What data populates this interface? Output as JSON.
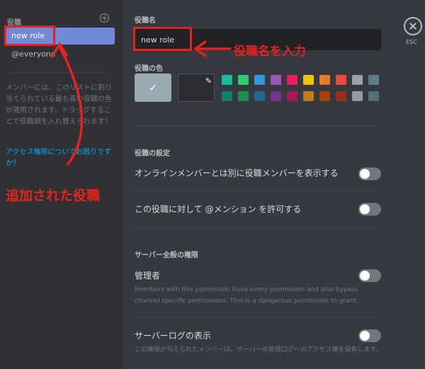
{
  "sidebar": {
    "title": "役職",
    "selected_role": "new role",
    "everyone_role": "@everyone",
    "description": "メンバーには、このリストに割り当てられている最も高い役職の色が適用されます。ドラッグすることで役職順を入れ替えられます！",
    "help_link": "アクセス権限についてお困りですか？"
  },
  "role_name": {
    "label": "役職名",
    "value": "new role"
  },
  "role_color": {
    "label": "役職の色",
    "default_color": "#99aab5",
    "swatches_top": [
      "#1abc9c",
      "#2ecc71",
      "#3498db",
      "#9b59b6",
      "#e91e63",
      "#f1c40f",
      "#e67e22",
      "#e74c3c",
      "#95a5a6",
      "#607d8b"
    ],
    "swatches_bottom": [
      "#11806a",
      "#1f8b4c",
      "#206694",
      "#71368a",
      "#ad1457",
      "#c27c0e",
      "#a84300",
      "#992d22",
      "#979c9f",
      "#546e7a"
    ]
  },
  "role_settings": {
    "section_title": "役職の設定",
    "hoist_label": "オンラインメンバーとは別に役職メンバーを表示する",
    "mention_label": "この役職に対して @メンション を許可する"
  },
  "server_permissions": {
    "section_title": "サーバー全般の権限",
    "admin_label": "管理者",
    "admin_desc": "Members with this permission have every permission and also bypass channel specific permissions. This is a dangerous permission to grant.",
    "audit_label": "サーバーログの表示",
    "audit_desc": "この権限が与えられたメンバーは、サーバーの管理ログへのアクセス権を保有します。"
  },
  "esc": {
    "label": "ESC"
  },
  "annotations": {
    "added_role": "追加された役職",
    "enter_name": "役職名を入力",
    "color": "#e8231d"
  },
  "toggles": {
    "hoist_on": false,
    "mention_on": false,
    "admin_on": false,
    "audit_on": false
  }
}
